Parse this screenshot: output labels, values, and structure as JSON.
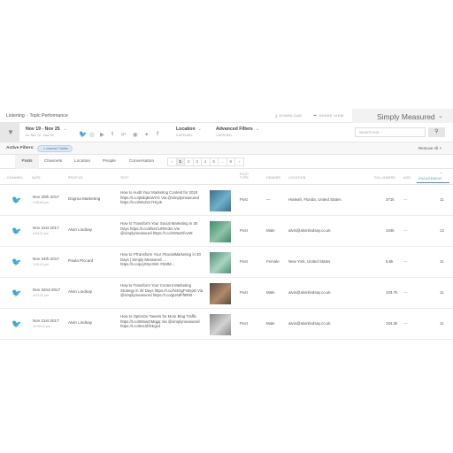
{
  "topbar": {
    "breadcrumb_root": "Listening",
    "breadcrumb_separator": "›",
    "breadcrumb_page": "Topic Performance",
    "download_label": "DOWNLOAD",
    "share_label": "SHARE VIEW",
    "brand": "Simply Measured"
  },
  "filters": {
    "date_range": "Nov 19 - Nov 25",
    "date_compare": "vs. Nov 12 - Nov 18",
    "location_label": "Location",
    "location_sub": "0 APPLIED",
    "advanced_label": "Advanced Filters",
    "advanced_sub": "1 APPLIED",
    "search_placeholder": "Search text..."
  },
  "active_filters": {
    "label": "Active Filters:",
    "chip": "channel: Twitter",
    "remove_all": "Remove All"
  },
  "tabs": [
    "Posts",
    "Channels",
    "Location",
    "People",
    "Conversation"
  ],
  "pagination": [
    "‹",
    "1",
    "2",
    "3",
    "4",
    "5",
    "…",
    "9",
    "›"
  ],
  "columns": {
    "channel": "CHANNEL",
    "date": "DATE",
    "profile": "PROFILE",
    "text": "TEXT",
    "post_type_1": "POST",
    "post_type_2": "TYPE",
    "gender": "GENDER",
    "location": "LOCATION",
    "followers": "FOLLOWERS",
    "age": "AGE",
    "engagement": "ENGAGEMENT"
  },
  "rows": [
    {
      "date": "Nov 20th 2017",
      "time": "2:06:05 pm",
      "profile": "Dogma Marketing",
      "text": "How to Audit Your Marketing Content for 2018 https://t.co/jBdqBxWVG Via @simplymeasured https://t.co/WvZvn7HLp5",
      "post_type": "Post",
      "gender": "—",
      "location": "Hialeah, Florida, United States",
      "followers": "371k",
      "age": "—",
      "engagement": "11",
      "thumb_colors": [
        "#3a6f8f",
        "#6fb0c9"
      ]
    },
    {
      "date": "Nov 21st 2017",
      "time": "5:04:31 pm",
      "profile": "Alvin Lindsay",
      "text": "How to Transform Your Social Marketing in 30 Days https://t.co/dNeCUR9c3m Via @simplymeasured https://t.co/G8twGfvvn8",
      "post_type": "Post",
      "gender": "Male",
      "location": "alvin@alvinlindsay.co.uk",
      "followers": "104k",
      "age": "—",
      "engagement": "12",
      "thumb_colors": [
        "#3b8e6e",
        "#8fc3a6"
      ]
    },
    {
      "date": "Nov 24th 2017",
      "time": "1:06:31 pm",
      "profile": "Paula Piccard",
      "text": "How to #Transform Your #SocialMarketing in 30 Days | Simply Measured … https://t.co/pcjX9yr4Wc #SMM…",
      "post_type": "Post",
      "gender": "Female",
      "location": "New York, United States",
      "followers": "6.6k",
      "age": "—",
      "engagement": "11",
      "thumb_colors": [
        "#4f8f7a",
        "#a9d4c0"
      ]
    },
    {
      "date": "Nov 22nd 2017",
      "time": "4:03:11 pm",
      "profile": "Alvin Lindsay",
      "text": "How to Transform Your Content Marketing Strategy in 30 Days https://t.co/N4GgFVEIpD Via @simplymeasured https://t.co/gU6dFf8R8t",
      "post_type": "Post",
      "gender": "Male",
      "location": "alvin@alvinlindsay.co.uk",
      "followers": "103.7k",
      "age": "—",
      "engagement": "11",
      "thumb_colors": [
        "#5a4a3f",
        "#b08a6a"
      ]
    },
    {
      "date": "Nov 21st 2017",
      "time": "10:49:41 pm",
      "profile": "Alvin Lindsay",
      "text": "How to Optimize Tweets for More Blog Traffic https://t.co/t8mwGMqgq Via @simplymeasured https://t.co/6eUZfXEgx4",
      "post_type": "Post",
      "gender": "Male",
      "location": "alvin@alvinlindsay.co.uk",
      "followers": "104.3k",
      "age": "—",
      "engagement": "11",
      "thumb_colors": [
        "#8a8a8a",
        "#d3d3d3"
      ]
    }
  ]
}
